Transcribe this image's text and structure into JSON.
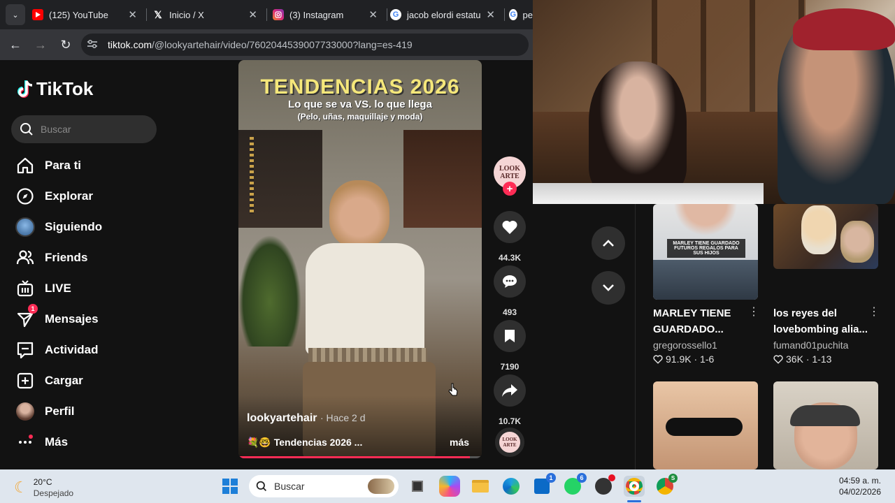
{
  "browser": {
    "tabs": [
      {
        "title": "(125) YouTube",
        "icon": "youtube-icon"
      },
      {
        "title": "Inicio / X",
        "icon": "x-icon"
      },
      {
        "title": "(3) Instagram",
        "icon": "instagram-icon"
      },
      {
        "title": "jacob elordi estatu",
        "icon": "google-icon"
      },
      {
        "title": "pe",
        "icon": "google-icon"
      }
    ],
    "url_host": "tiktok.com",
    "url_path": "/@lookyartehair/video/7602044539007733000?lang=es-419"
  },
  "tiktok": {
    "logo": "TikTok",
    "search_placeholder": "Buscar",
    "nav": [
      {
        "label": "Para ti",
        "icon": "home-icon"
      },
      {
        "label": "Explorar",
        "icon": "compass-icon"
      },
      {
        "label": "Siguiendo",
        "icon": "following-avatar-icon"
      },
      {
        "label": "Friends",
        "icon": "friends-icon"
      },
      {
        "label": "LIVE",
        "icon": "live-icon"
      },
      {
        "label": "Mensajes",
        "icon": "send-icon",
        "badge": "1"
      },
      {
        "label": "Actividad",
        "icon": "activity-icon"
      },
      {
        "label": "Cargar",
        "icon": "upload-icon"
      },
      {
        "label": "Perfil",
        "icon": "profile-avatar-icon"
      },
      {
        "label": "Más",
        "icon": "more-dots-icon"
      }
    ]
  },
  "video": {
    "title_line1": "TENDENCIAS 2026",
    "title_line2": "Lo que se va  VS.  lo que llega",
    "title_line3": "(Pelo, uñas, maquillaje y moda)",
    "author": "lookyartehair",
    "time_ago": "· Hace 2 d",
    "caption": "💐🤓 Tendencias 2026 ...",
    "more": "más",
    "progress": 0.95,
    "avatar_text_top": "LOOK",
    "avatar_text_bottom": "ARTE"
  },
  "actions": {
    "likes": "44.3K",
    "comments": "493",
    "saves": "7190",
    "shares": "10.7K"
  },
  "suggestions": [
    {
      "title": "MARLEY TIENE GUARDADO...",
      "author": "gregorossello1",
      "likes": "91.9K",
      "date": "· 1-6",
      "overlay": "MARLEY TIENE GUARDADO FUTUROS REGALOS PARA SUS HIJOS"
    },
    {
      "title": "los reyes del lovebombing alia...",
      "author": "fumand01puchita",
      "likes": "36K",
      "date": "· 1-13"
    }
  ],
  "taskbar": {
    "weather_temp": "20°C",
    "weather_desc": "Despejado",
    "search_label": "Buscar",
    "time": "04:59 a. m.",
    "date": "04/02/2026",
    "badges": {
      "store": "1",
      "whatsapp": "6"
    }
  },
  "colors": {
    "accent": "#fe2c55",
    "title_yellow": "#f5e77a"
  }
}
